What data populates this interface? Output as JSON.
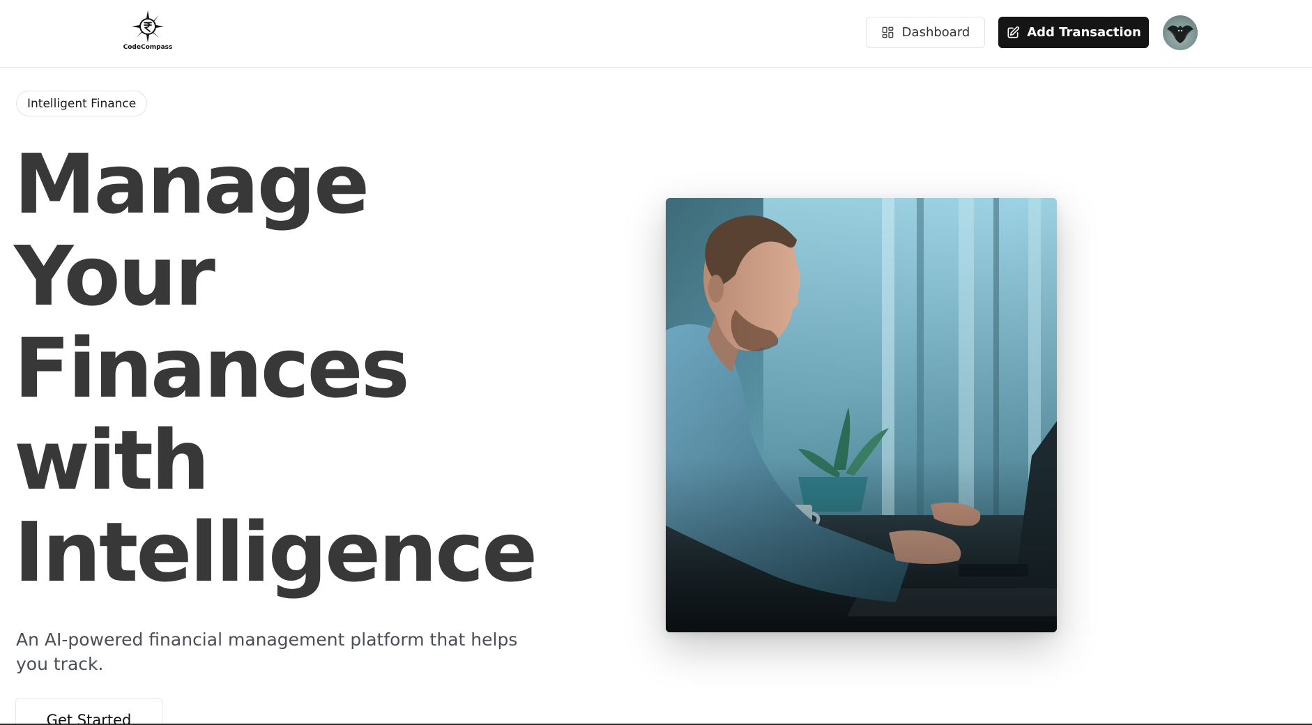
{
  "brand": {
    "name": "CodeCompass",
    "logo_icon": "rupee-compass-icon"
  },
  "header": {
    "dashboard_label": "Dashboard",
    "dashboard_icon": "layout-grid-icon",
    "add_transaction_label": "Add Transaction",
    "add_transaction_icon": "pen-square-icon",
    "avatar_icon": "user-avatar"
  },
  "hero": {
    "badge": "Intelligent Finance",
    "title_lines": [
      "Manage",
      "Your",
      "Finances",
      "with",
      "Intelligence"
    ],
    "subtitle": "An AI-powered financial management platform that helps you track.",
    "cta_label": "Get Started",
    "image_icon": "man-at-laptop-photo"
  },
  "colors": {
    "text": "#383838",
    "primary_button_bg": "#151515",
    "primary_button_text": "#ffffff",
    "border": "#e3e3e3",
    "photo_tone": "#5e9bb0"
  }
}
